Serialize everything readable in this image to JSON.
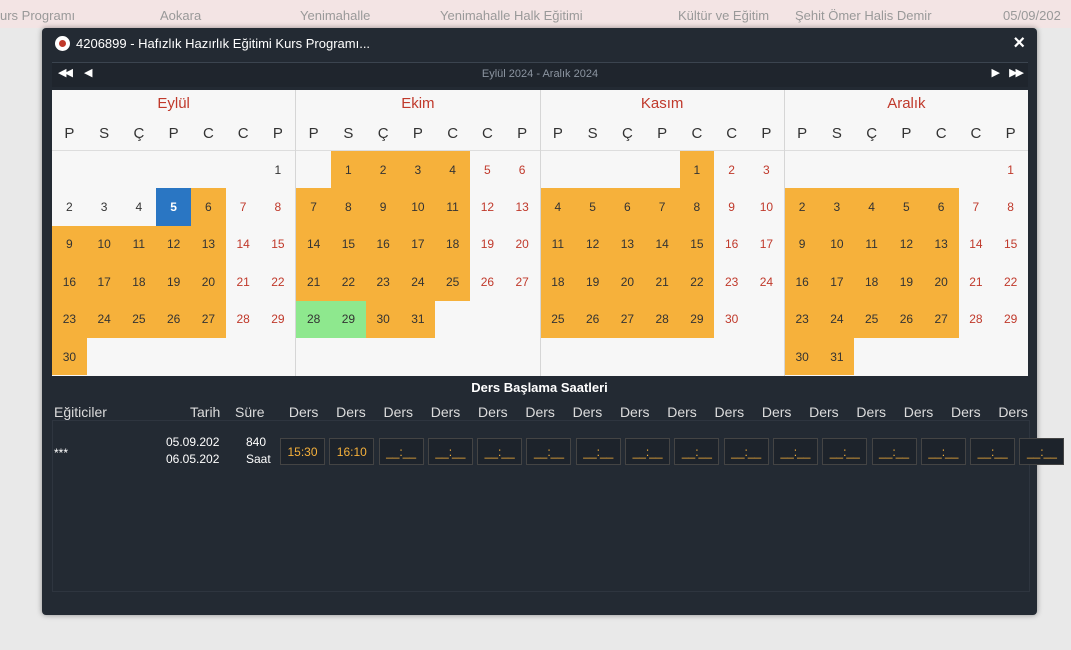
{
  "background": {
    "cells": [
      "urs Programı",
      "Aokara",
      "Yenimahalle",
      "Yenimahalle Halk Eğitimi",
      "Kültür ve Eğitim",
      "Şehit Ömer Halis Demir",
      "05/09/202"
    ]
  },
  "modal": {
    "title": "4206899 - Hafızlık Hazırlık Eğitimi Kurs Programı...",
    "close": "×",
    "nav": {
      "first": "◀◀",
      "prev": "◀",
      "range": "Eylül 2024 - Aralık 2024",
      "next": "▶",
      "last": "▶▶"
    }
  },
  "dow": [
    "P",
    "S",
    "Ç",
    "P",
    "C",
    "C",
    "P"
  ],
  "months": [
    {
      "name": "Eylül",
      "offset": 6,
      "days": [
        {
          "n": "1",
          "k": ""
        },
        {
          "n": "2",
          "k": ""
        },
        {
          "n": "3",
          "k": ""
        },
        {
          "n": "4",
          "k": ""
        },
        {
          "n": "5",
          "k": "t"
        },
        {
          "n": "6",
          "k": "c"
        },
        {
          "n": "7",
          "k": "w"
        },
        {
          "n": "8",
          "k": "w"
        },
        {
          "n": "9",
          "k": "c"
        },
        {
          "n": "10",
          "k": "c"
        },
        {
          "n": "11",
          "k": "c"
        },
        {
          "n": "12",
          "k": "c"
        },
        {
          "n": "13",
          "k": "c"
        },
        {
          "n": "14",
          "k": "w"
        },
        {
          "n": "15",
          "k": "w"
        },
        {
          "n": "16",
          "k": "c"
        },
        {
          "n": "17",
          "k": "c"
        },
        {
          "n": "18",
          "k": "c"
        },
        {
          "n": "19",
          "k": "c"
        },
        {
          "n": "20",
          "k": "c"
        },
        {
          "n": "21",
          "k": "w"
        },
        {
          "n": "22",
          "k": "w"
        },
        {
          "n": "23",
          "k": "c"
        },
        {
          "n": "24",
          "k": "c"
        },
        {
          "n": "25",
          "k": "c"
        },
        {
          "n": "26",
          "k": "c"
        },
        {
          "n": "27",
          "k": "c"
        },
        {
          "n": "28",
          "k": "w"
        },
        {
          "n": "29",
          "k": "w"
        },
        {
          "n": "30",
          "k": "c"
        }
      ]
    },
    {
      "name": "Ekim",
      "offset": 1,
      "days": [
        {
          "n": "1",
          "k": "c"
        },
        {
          "n": "2",
          "k": "c"
        },
        {
          "n": "3",
          "k": "c"
        },
        {
          "n": "4",
          "k": "c"
        },
        {
          "n": "5",
          "k": "w"
        },
        {
          "n": "6",
          "k": "w"
        },
        {
          "n": "7",
          "k": "c"
        },
        {
          "n": "8",
          "k": "c"
        },
        {
          "n": "9",
          "k": "c"
        },
        {
          "n": "10",
          "k": "c"
        },
        {
          "n": "11",
          "k": "c"
        },
        {
          "n": "12",
          "k": "w"
        },
        {
          "n": "13",
          "k": "w"
        },
        {
          "n": "14",
          "k": "c"
        },
        {
          "n": "15",
          "k": "c"
        },
        {
          "n": "16",
          "k": "c"
        },
        {
          "n": "17",
          "k": "c"
        },
        {
          "n": "18",
          "k": "c"
        },
        {
          "n": "19",
          "k": "w"
        },
        {
          "n": "20",
          "k": "w"
        },
        {
          "n": "21",
          "k": "c"
        },
        {
          "n": "22",
          "k": "c"
        },
        {
          "n": "23",
          "k": "c"
        },
        {
          "n": "24",
          "k": "c"
        },
        {
          "n": "25",
          "k": "c"
        },
        {
          "n": "26",
          "k": "w"
        },
        {
          "n": "27",
          "k": "w"
        },
        {
          "n": "28",
          "k": "s"
        },
        {
          "n": "29",
          "k": "s"
        },
        {
          "n": "30",
          "k": "c"
        },
        {
          "n": "31",
          "k": "c"
        }
      ]
    },
    {
      "name": "Kasım",
      "offset": 4,
      "days": [
        {
          "n": "1",
          "k": "c"
        },
        {
          "n": "2",
          "k": "w"
        },
        {
          "n": "3",
          "k": "w"
        },
        {
          "n": "4",
          "k": "c"
        },
        {
          "n": "5",
          "k": "c"
        },
        {
          "n": "6",
          "k": "c"
        },
        {
          "n": "7",
          "k": "c"
        },
        {
          "n": "8",
          "k": "c"
        },
        {
          "n": "9",
          "k": "w"
        },
        {
          "n": "10",
          "k": "w"
        },
        {
          "n": "11",
          "k": "c"
        },
        {
          "n": "12",
          "k": "c"
        },
        {
          "n": "13",
          "k": "c"
        },
        {
          "n": "14",
          "k": "c"
        },
        {
          "n": "15",
          "k": "c"
        },
        {
          "n": "16",
          "k": "w"
        },
        {
          "n": "17",
          "k": "w"
        },
        {
          "n": "18",
          "k": "c"
        },
        {
          "n": "19",
          "k": "c"
        },
        {
          "n": "20",
          "k": "c"
        },
        {
          "n": "21",
          "k": "c"
        },
        {
          "n": "22",
          "k": "c"
        },
        {
          "n": "23",
          "k": "w"
        },
        {
          "n": "24",
          "k": "w"
        },
        {
          "n": "25",
          "k": "c"
        },
        {
          "n": "26",
          "k": "c"
        },
        {
          "n": "27",
          "k": "c"
        },
        {
          "n": "28",
          "k": "c"
        },
        {
          "n": "29",
          "k": "c"
        },
        {
          "n": "30",
          "k": "w"
        }
      ]
    },
    {
      "name": "Aralık",
      "offset": 6,
      "days": [
        {
          "n": "1",
          "k": "w"
        },
        {
          "n": "2",
          "k": "c"
        },
        {
          "n": "3",
          "k": "c"
        },
        {
          "n": "4",
          "k": "c"
        },
        {
          "n": "5",
          "k": "c"
        },
        {
          "n": "6",
          "k": "c"
        },
        {
          "n": "7",
          "k": "w"
        },
        {
          "n": "8",
          "k": "w"
        },
        {
          "n": "9",
          "k": "c"
        },
        {
          "n": "10",
          "k": "c"
        },
        {
          "n": "11",
          "k": "c"
        },
        {
          "n": "12",
          "k": "c"
        },
        {
          "n": "13",
          "k": "c"
        },
        {
          "n": "14",
          "k": "w"
        },
        {
          "n": "15",
          "k": "w"
        },
        {
          "n": "16",
          "k": "c"
        },
        {
          "n": "17",
          "k": "c"
        },
        {
          "n": "18",
          "k": "c"
        },
        {
          "n": "19",
          "k": "c"
        },
        {
          "n": "20",
          "k": "c"
        },
        {
          "n": "21",
          "k": "w"
        },
        {
          "n": "22",
          "k": "w"
        },
        {
          "n": "23",
          "k": "c"
        },
        {
          "n": "24",
          "k": "c"
        },
        {
          "n": "25",
          "k": "c"
        },
        {
          "n": "26",
          "k": "c"
        },
        {
          "n": "27",
          "k": "c"
        },
        {
          "n": "28",
          "k": "w"
        },
        {
          "n": "29",
          "k": "w"
        },
        {
          "n": "30",
          "k": "c"
        },
        {
          "n": "31",
          "k": "c"
        }
      ]
    }
  ],
  "schedule": {
    "section_title": "Ders Başlama Saatleri",
    "col_trainers": "Eğiticiler",
    "col_date": "Tarih",
    "col_duration": "Süre",
    "lesson_header": "Ders",
    "lesson_count": 16,
    "row": {
      "trainer": "***",
      "date_start": "05.09.202",
      "date_end": "06.05.202",
      "duration_value": "840",
      "duration_unit": "Saat",
      "times": [
        "15:30",
        "16:10",
        "__:__",
        "__:__",
        "__:__",
        "__:__",
        "__:__",
        "__:__",
        "__:__",
        "__:__",
        "__:__",
        "__:__",
        "__:__",
        "__:__",
        "__:__",
        "__:__"
      ]
    }
  },
  "colors": {
    "course_day": "#f6b13b",
    "selected_day": "#8ee88e",
    "today": "#2a76c3",
    "weekend_text": "#c0392b",
    "modal_bg": "#232a33"
  }
}
